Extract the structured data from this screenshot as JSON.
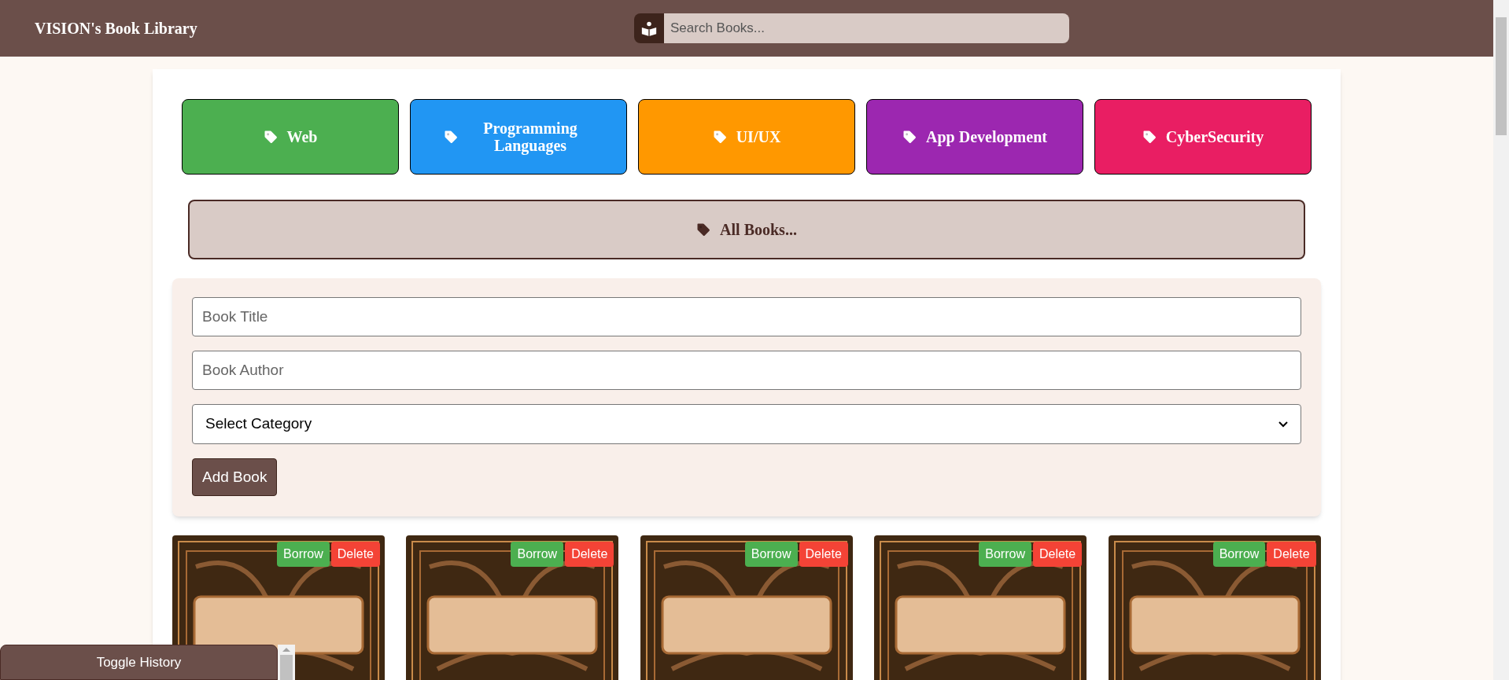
{
  "header": {
    "title": "VISION's Book Library",
    "search": {
      "placeholder": "Search Books..."
    }
  },
  "categories": [
    {
      "label": "Web",
      "color": "#4caf50"
    },
    {
      "label": "Programming Languages",
      "color": "#2196f3"
    },
    {
      "label": "UI/UX",
      "color": "#ff9800"
    },
    {
      "label": "App Development",
      "color": "#9c27b0"
    },
    {
      "label": "CyberSecurity",
      "color": "#e91e63"
    }
  ],
  "all_books": {
    "label": "All Books..."
  },
  "form": {
    "title_field": {
      "placeholder": "Book Title"
    },
    "author_field": {
      "placeholder": "Book Author"
    },
    "category_select": {
      "value": "Select Category"
    },
    "submit": "Add Book"
  },
  "books": [
    {
      "actions": [
        "Borrow",
        "Delete"
      ]
    },
    {
      "actions": [
        "Borrow",
        "Delete"
      ]
    },
    {
      "actions": [
        "Borrow",
        "Delete"
      ]
    },
    {
      "actions": [
        "Borrow",
        "Delete"
      ]
    },
    {
      "actions": [
        "Borrow",
        "Delete"
      ]
    }
  ],
  "history": {
    "toggle": "Toggle History"
  }
}
